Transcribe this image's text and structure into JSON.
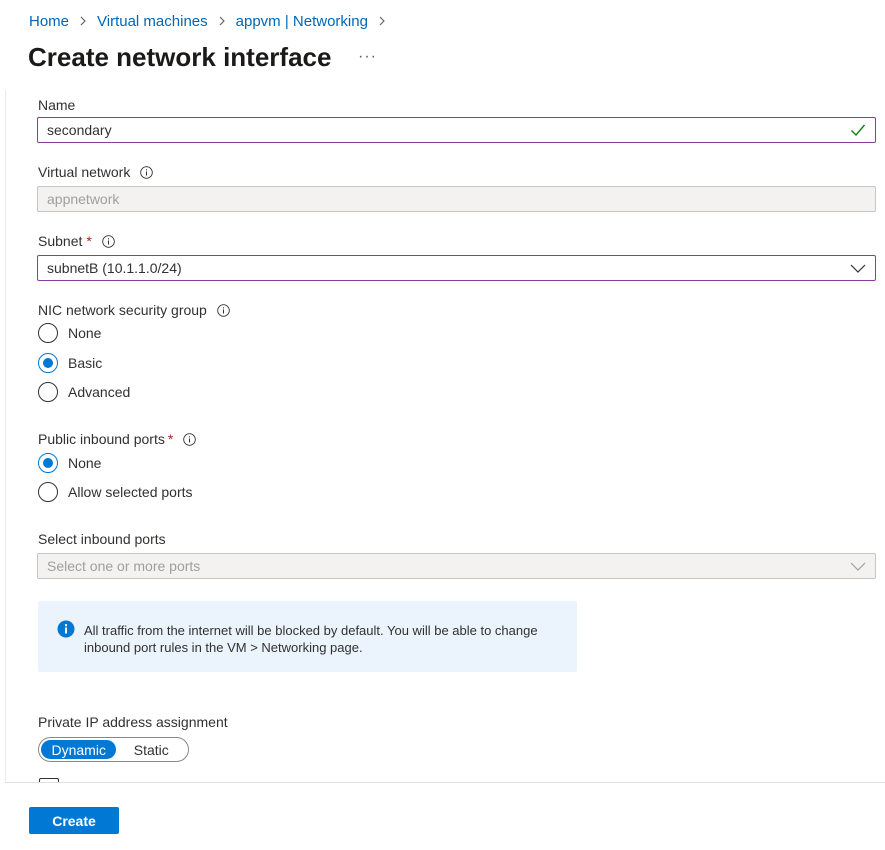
{
  "breadcrumb": [
    {
      "label": "Home"
    },
    {
      "label": "Virtual machines"
    },
    {
      "label": "appvm | Networking"
    }
  ],
  "page": {
    "title": "Create network interface",
    "more_label": "···"
  },
  "form": {
    "name": {
      "label": "Name",
      "value": "secondary"
    },
    "virtual_network": {
      "label": "Virtual network",
      "value": "appnetwork"
    },
    "subnet": {
      "label": "Subnet",
      "required_marker": "*",
      "value": "subnetB (10.1.1.0/24)"
    },
    "nic_nsg": {
      "label": "NIC network security group",
      "options": [
        {
          "label": "None",
          "selected": false
        },
        {
          "label": "Basic",
          "selected": true
        },
        {
          "label": "Advanced",
          "selected": false
        }
      ]
    },
    "public_inbound_ports": {
      "label": "Public inbound ports",
      "required_marker": "*",
      "options": [
        {
          "label": "None",
          "selected": true
        },
        {
          "label": "Allow selected ports",
          "selected": false
        }
      ]
    },
    "select_inbound_ports": {
      "label": "Select inbound ports",
      "placeholder": "Select one or more ports"
    },
    "info_message": "All traffic from the internet will be blocked by default. You will be able to change inbound port rules in the VM > Networking page.",
    "private_ip": {
      "label": "Private IP address assignment",
      "options": [
        {
          "label": "Dynamic",
          "selected": true
        },
        {
          "label": "Static",
          "selected": false
        }
      ]
    }
  },
  "footer": {
    "create_label": "Create"
  },
  "colors": {
    "accent": "#0078d4",
    "link": "#0067b8",
    "required": "#a4262c",
    "active_border": "#8a3e9b",
    "valid_check": "#107c10",
    "info_bg": "#ebf3fc"
  },
  "icons": {
    "breadcrumb_separator": "chevron-right-icon",
    "info": "info-circle-icon",
    "valid": "checkmark-icon",
    "dropdown": "chevron-down-icon",
    "message": "info-filled-icon"
  }
}
